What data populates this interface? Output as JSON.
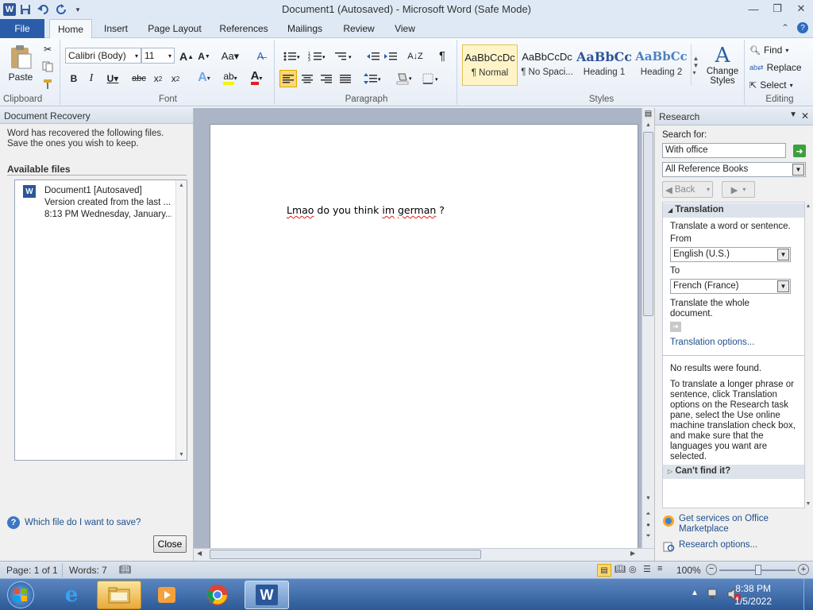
{
  "title": "Document1 (Autosaved)  -  Microsoft Word (Safe Mode)",
  "tabs": [
    "File",
    "Home",
    "Insert",
    "Page Layout",
    "References",
    "Mailings",
    "Review",
    "View"
  ],
  "ribbon": {
    "clipboard": {
      "paste": "Paste",
      "label": "Clipboard"
    },
    "font": {
      "name": "Calibri (Body)",
      "size": "11",
      "label": "Font"
    },
    "paragraph": {
      "label": "Paragraph"
    },
    "styles": {
      "label": "Styles",
      "items": [
        {
          "sample": "AaBbCcDc",
          "name": "¶ Normal"
        },
        {
          "sample": "AaBbCcDc",
          "name": "¶ No Spaci..."
        },
        {
          "sample": "AaBbCc",
          "name": "Heading 1"
        },
        {
          "sample": "AaBbCc",
          "name": "Heading 2"
        }
      ],
      "change": "Change",
      "change2": "Styles"
    },
    "editing": {
      "find": "Find",
      "replace": "Replace",
      "select": "Select",
      "label": "Editing"
    }
  },
  "recovery": {
    "header": "Document Recovery",
    "message": "Word has recovered the following files.  Save the ones you wish to keep.",
    "available": "Available files",
    "file": {
      "name": "Document1  [Autosaved]",
      "line2": "Version created from the last ...",
      "line3": "8:13 PM Wednesday, January..."
    },
    "help": "Which file do I want to save?",
    "close": "Close"
  },
  "document": {
    "word1": "Lmao",
    "mid": " do you think ",
    "word2": "im",
    "sp": " ",
    "word3": "german",
    "tail": " ?"
  },
  "research": {
    "header": "Research",
    "search_label": "Search for:",
    "search_value": "With office",
    "source": "All Reference Books",
    "back": "Back",
    "translation": "Translation",
    "translate_word": "Translate a word or sentence.",
    "from_label": "From",
    "from_value": "English (U.S.)",
    "to_label": "To",
    "to_value": "French (France)",
    "translate_doc": "Translate the whole document.",
    "options_link": "Translation options...",
    "no_results": "No results were found.",
    "long_text": "To translate a longer phrase or sentence, click Translation options on the Research task pane, select the Use online machine translation check box, and make sure that the languages you want are selected.",
    "cant_find": "Can't find it?",
    "marketplace": "Get services on Office Marketplace",
    "research_options": "Research options..."
  },
  "status": {
    "page": "Page: 1 of 1",
    "words": "Words: 7",
    "zoom": "100%"
  },
  "taskbar": {
    "time": "8:38 PM",
    "date": "1/5/2022"
  }
}
